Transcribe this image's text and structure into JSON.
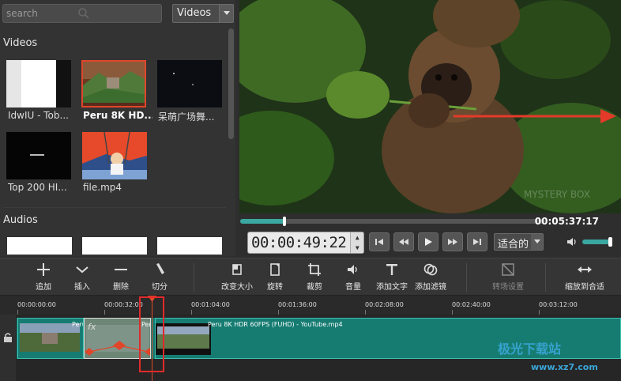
{
  "search": {
    "placeholder": "search"
  },
  "library": {
    "type_selected": "Videos",
    "videos_heading": "Videos",
    "audios_heading": "Audios",
    "items": [
      {
        "label": "IdwIU - Tob..."
      },
      {
        "label": "Peru 8K HD...",
        "selected": true
      },
      {
        "label": "呆萌广场舞..."
      },
      {
        "label": "Top 200 HI..."
      },
      {
        "label": "file.mp4"
      }
    ]
  },
  "player": {
    "duration": "00:05:37:17",
    "timecode": "00:00:49:22",
    "progress_fraction": 0.145,
    "zoom_selected": "适合的",
    "volume_fraction": 1.0,
    "preview_overlay_text": "MYSTERY BOX"
  },
  "toolbar": {
    "append": "追加",
    "insert": "插入",
    "delete": "删除",
    "split": "切分",
    "resize": "改变大小",
    "rotate": "旋转",
    "crop": "裁剪",
    "volume": "音量",
    "add_text": "添加文字",
    "add_filter": "添加滤镜",
    "transition": "转场设置",
    "zoom_fit": "缩放到合适"
  },
  "timeline": {
    "ticks": [
      "00:00:00:00",
      "00:00:32:00",
      "00:01:04:00",
      "00:01:36:00",
      "00:02:08:00",
      "00:02:40:00",
      "00:03:12:00"
    ],
    "clip_title": "Peru 8K HDR 60FPS (FUHD) - YouTube.mp4",
    "clip_short_a": "Peru",
    "clip_short_b": "Peru",
    "fx_label": "fx"
  },
  "watermark": {
    "name": "极光下载站",
    "url": "www.xz7.com"
  },
  "colors": {
    "accent": "#3aa7a0",
    "track": "#167c72",
    "annotation_red": "#e12a2a"
  }
}
